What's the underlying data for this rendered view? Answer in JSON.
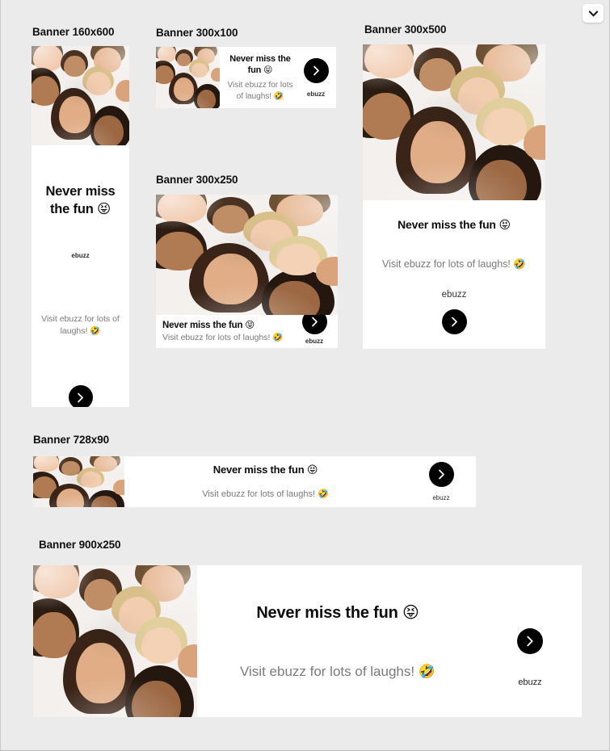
{
  "page": {
    "background_color": "#ebebeb",
    "collapse_control": {
      "icon": "chevron-down-icon"
    }
  },
  "shared": {
    "headline": "Never miss the fun",
    "headline_emoji": "😝",
    "subline": "Visit ebuzz for lots of laughs!",
    "subline_emoji": "🤣",
    "brand": "ebuzz",
    "cta_icon": "chevron-right-icon",
    "cta_color": "#000000",
    "photo_alt": "group-selfie-photo"
  },
  "banners": [
    {
      "id": "160x600",
      "label": "Banner 160x600",
      "headline": "Never miss the fun",
      "headline_line1": "Never miss",
      "headline_line2": "the fun",
      "headline_emoji": "😝",
      "subline": "Visit ebuzz for lots of",
      "subline_line2": "laughs!",
      "subline_emoji": "🤣",
      "brand": "ebuzz"
    },
    {
      "id": "300x100",
      "label": "Banner 300x100",
      "headline": "Never miss the fun",
      "headline_emoji": "😝",
      "subline": "Visit ebuzz for lots of",
      "subline_line2": "laughs!",
      "subline_emoji": "🤣",
      "brand": "ebuzz"
    },
    {
      "id": "300x250",
      "label": "Banner 300x250",
      "headline": "Never miss the fun",
      "headline_emoji": "😝",
      "subline": "Visit ebuzz for lots of laughs!",
      "subline_emoji": "🤣",
      "brand": "ebuzz"
    },
    {
      "id": "300x500",
      "label": "Banner 300x500",
      "headline": "Never miss the fun",
      "headline_emoji": "😝",
      "subline": "Visit ebuzz for lots of laughs!",
      "subline_emoji": "🤣",
      "brand": "ebuzz"
    },
    {
      "id": "728x90",
      "label": "Banner 728x90",
      "headline": "Never miss the fun",
      "headline_emoji": "😝",
      "subline": "Visit ebuzz for lots of laughs!",
      "subline_emoji": "🤣",
      "brand": "ebuzz"
    },
    {
      "id": "900x250",
      "label": "Banner 900x250",
      "headline": "Never miss the fun",
      "headline_emoji": "😝",
      "subline": "Visit ebuzz for lots of laughs!",
      "subline_emoji": "🤣",
      "brand": "ebuzz"
    }
  ]
}
